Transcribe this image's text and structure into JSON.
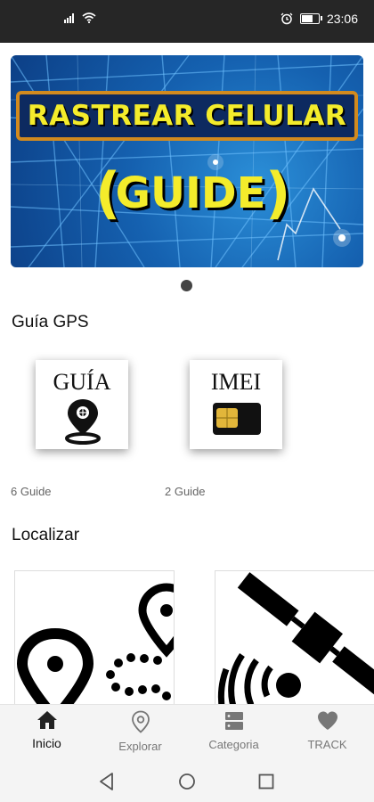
{
  "status_bar": {
    "time": "23:06"
  },
  "banner": {
    "title": "RASTREAR CELULAR",
    "subtitle": "GUIDE",
    "icon": "phone-on-map-illustration"
  },
  "sections": {
    "gps": {
      "title": "Guía GPS",
      "cards": [
        {
          "label": "GUÍA",
          "count": "6 Guide",
          "icon": "map-pin-icon"
        },
        {
          "label": "IMEI",
          "count": "2 Guide",
          "icon": "sim-card-icon"
        }
      ]
    },
    "localizar": {
      "title": "Localizar",
      "cards": [
        {
          "icon": "route-pins-icon"
        },
        {
          "icon": "satellite-icon"
        }
      ]
    }
  },
  "bottom_nav": {
    "items": [
      {
        "label": "Inicio",
        "icon": "home-icon",
        "active": true
      },
      {
        "label": "Explorar",
        "icon": "location-pin-icon",
        "active": false
      },
      {
        "label": "Categoria",
        "icon": "server-icon",
        "active": false
      },
      {
        "label": "TRACK",
        "icon": "heart-icon",
        "active": false
      }
    ]
  },
  "colors": {
    "status_bar": "#262626",
    "banner_text": "#f4ec2b",
    "banner_border": "#d28a1f",
    "active_nav": "#111111",
    "inactive_nav": "#777777"
  }
}
